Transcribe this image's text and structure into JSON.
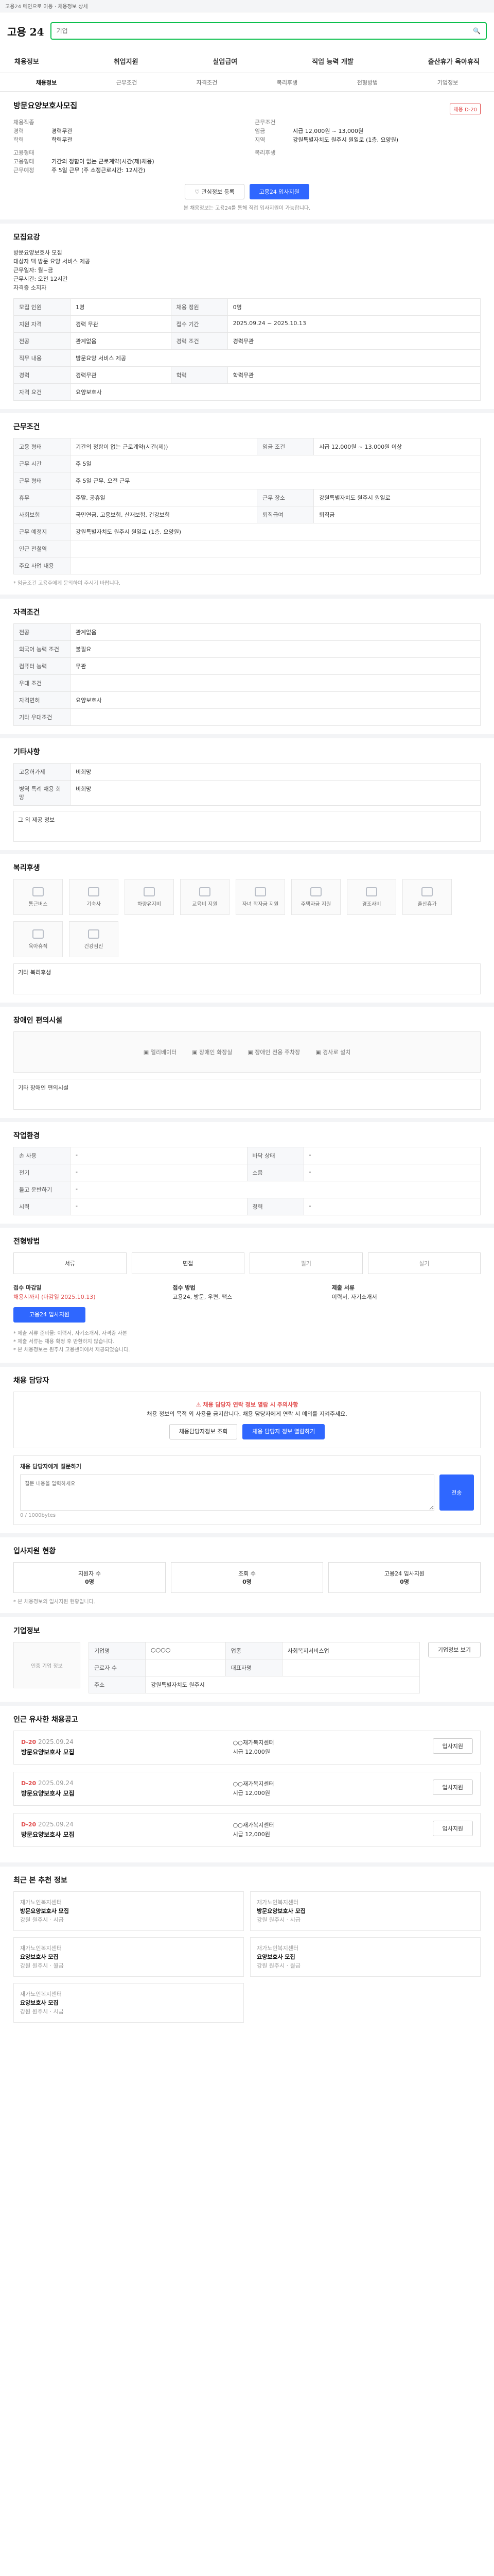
{
  "topbar": {
    "text": "고용24 메인으로 이동 · 채용정보 상세"
  },
  "header": {
    "logo": "고용 24",
    "search_placeholder": "기업"
  },
  "gnb": [
    "채용정보",
    "취업지원",
    "실업급여",
    "직업 능력 개발",
    "출산휴가 육아휴직"
  ],
  "subnav": [
    "채용정보",
    "근무조건",
    "자격조건",
    "복리후생",
    "전형방법",
    "기업정보"
  ],
  "job": {
    "title": "방문요양보호사모집",
    "badge": "채용 D-20",
    "left": [
      {
        "k": "채용직종",
        "v": ""
      },
      {
        "k": "경력",
        "v": "경력무관"
      },
      {
        "k": "학력",
        "v": "학력무관"
      },
      {
        "k": "고용형태",
        "v": ""
      },
      {
        "k": "고용형태",
        "v": "기간의 정함이 없는 근로계약(시간(제)채용)"
      },
      {
        "k": "근무예정",
        "v": "주 5일 근무 (주 소정근로시간: 12시간)"
      }
    ],
    "right": [
      {
        "k": "근무조건",
        "v": ""
      },
      {
        "k": "임금",
        "v": "시급 12,000원 ~ 13,000원"
      },
      {
        "k": "지역",
        "v": "강원특별자치도 원주시 원일로 (1층, 요양원)"
      },
      {
        "k": "복리후생",
        "v": ""
      }
    ],
    "buttons": {
      "save": "관심정보 등록",
      "apply": "고용24 입사지원"
    },
    "note": "본 채용정보는 고용24를 통해 직접 입사지원이 가능합니다."
  },
  "recruit": {
    "title": "모집요강",
    "desc": [
      "방문요양보호사 모집",
      "대상자 댁 방문 요양 서비스 제공",
      "근무일자: 월~금",
      "근무시간: 오전 12시간",
      "자격증 소지자"
    ],
    "rows": [
      [
        "모집 인원",
        "1명",
        "채용 정원",
        "0명"
      ],
      [
        "지원 자격",
        "경력 무관",
        "접수 기간",
        "2025.09.24 ~ 2025.10.13"
      ],
      [
        "전공",
        "관계없음",
        "경력 조건",
        "경력무관"
      ],
      [
        "직무 내용",
        "방문요양 서비스 제공",
        "",
        ""
      ],
      [
        "경력",
        "경력무관",
        "학력",
        "학력무관"
      ],
      [
        "자격 요건",
        "요양보호사",
        "",
        ""
      ]
    ]
  },
  "conditions": {
    "title": "근무조건",
    "rows": [
      [
        "고용 형태",
        "기간의 정함이 없는 근로계약(시간(제))",
        "임금 조건",
        "시급 12,000원 ~ 13,000원 이상"
      ],
      [
        "근무 시간",
        "주 5일",
        "",
        ""
      ],
      [
        "근무 형태",
        "주 5일 근무, 오전 근무",
        "",
        ""
      ],
      [
        "휴무",
        "주말, 공휴일",
        "근무 장소",
        "강원특별자치도 원주시 원일로"
      ],
      [
        "사회보험",
        "국민연금, 고용보험, 산재보험, 건강보험",
        "퇴직급여",
        "퇴직금"
      ],
      [
        "근무 예정지",
        "강원특별자치도 원주시 원일로 (1층, 요양원)",
        "",
        ""
      ],
      [
        "인근 전철역",
        "",
        "",
        ""
      ],
      [
        "주요 사업 내용",
        "",
        "",
        ""
      ]
    ],
    "note": "* 임금조건 고용주에게 문의하여 주시기 바랍니다."
  },
  "qualification": {
    "title": "자격조건",
    "rows": [
      [
        "전공",
        "관계없음"
      ],
      [
        "외국어 능력 조건",
        "불필요"
      ],
      [
        "컴퓨터 능력",
        "무관"
      ],
      [
        "우대 조건",
        ""
      ],
      [
        "자격면허",
        "요양보호사"
      ],
      [
        "기타 우대조건",
        ""
      ]
    ]
  },
  "etc": {
    "title": "기타사항",
    "rows": [
      [
        "고용허가제",
        "비희망"
      ],
      [
        "병역 특례 채용 희망",
        "비희망"
      ]
    ],
    "note": "그 외 제공 정보"
  },
  "welfare": {
    "title": "복리후생",
    "items": [
      "통근버스",
      "기숙사",
      "차량유지비",
      "교육비 지원",
      "자녀 학자금 지원",
      "주택자금 지원",
      "경조사비",
      "출산휴가",
      "육아휴직",
      "건강검진"
    ],
    "note": "기타 복리후생"
  },
  "disabled": {
    "title": "장애인 편의시설",
    "items": [
      "엘리베이터",
      "장애인 화장실",
      "장애인 전용 주차장",
      "경사로 설치"
    ],
    "note": "기타 장애인 편의시설"
  },
  "workplace": {
    "title": "작업환경",
    "rows": [
      [
        "손 사용",
        "-",
        "바닥 상태",
        "-"
      ],
      [
        "전기",
        "-",
        "소음",
        "-"
      ],
      [
        "들고 운반하기",
        "-",
        "",
        ""
      ],
      [
        "시력",
        "-",
        "청력",
        "-"
      ]
    ]
  },
  "selection": {
    "title": "전형방법",
    "steps": [
      "서류",
      "면접",
      "필기",
      "실기"
    ],
    "apply": [
      {
        "k": "접수 마감일",
        "v": "채용시까지 (마감일 2025.10.13)"
      },
      {
        "k": "접수 방법",
        "v": "고용24, 방문, 우편, 팩스"
      },
      {
        "k": "제출 서류",
        "v": "이력서, 자기소개서"
      }
    ],
    "apply_button": "고용24 입사지원",
    "notes": [
      "* 제출 서류 준비물: 이력서, 자기소개서, 자격증 사본",
      "* 제출 서류는 채용 확정 후 반환하지 않습니다.",
      "* 본 채용정보는 원주시 고용센터에서 제공되었습니다."
    ]
  },
  "contact": {
    "title": "채용 담당자",
    "warn_title": "채용 담당자 연락 정보 열람 시 주의사항",
    "warn_text": "채용 정보의 목적 외 사용을 금지합니다. 채용 담당자에게 연락 시 예의를 지켜주세요.",
    "btn1": "채용담당자정보 조회",
    "btn2": "채용 담당자 정보 열람하기",
    "inquiry_title": "채용 담당자에게 질문하기",
    "inquiry_placeholder": "질문 내용을 입력하세요",
    "count": "0 / 1000bytes",
    "send": "전송"
  },
  "matching": {
    "title": "입사지원 현황",
    "items": [
      {
        "k": "지원자 수",
        "v": "0명"
      },
      {
        "k": "조회 수",
        "v": "0명"
      },
      {
        "k": "고용24 입사지원",
        "v": "0명"
      }
    ],
    "note": "* 본 채용정보의 입사지원 현황입니다."
  },
  "company": {
    "title": "기업정보",
    "info_title": "인증 기업 정보",
    "rows": [
      [
        "기업명",
        "○○○○",
        "업종",
        "사회복지서비스업"
      ],
      [
        "근로자 수",
        "",
        "대표자명",
        ""
      ],
      [
        "주소",
        "강원특별자치도 원주시",
        "",
        ""
      ]
    ],
    "button": "기업정보 보기"
  },
  "similar": {
    "title": "인근 유사한 채용공고",
    "items": [
      {
        "dday": "D-20",
        "date": "2025.09.24",
        "title": "방문요양보호사 모집",
        "company": "○○재가복지센터",
        "pay": "시급 12,000원"
      },
      {
        "dday": "D-20",
        "date": "2025.09.24",
        "title": "방문요양보호사 모집",
        "company": "○○재가복지센터",
        "pay": "시급 12,000원"
      },
      {
        "dday": "D-20",
        "date": "2025.09.24",
        "title": "방문요양보호사 모집",
        "company": "○○재가복지센터",
        "pay": "시급 12,000원"
      }
    ],
    "more_button": "입사지원"
  },
  "recent": {
    "title": "최근 본 추천 정보",
    "cards": [
      {
        "tag": "재가노인복지센터",
        "title": "방문요양보호사 모집",
        "meta": "강원 원주시 · 시급"
      },
      {
        "tag": "재가노인복지센터",
        "title": "방문요양보호사 모집",
        "meta": "강원 원주시 · 시급"
      },
      {
        "tag": "재가노인복지센터",
        "title": "요양보호사 모집",
        "meta": "강원 원주시 · 월급"
      },
      {
        "tag": "재가노인복지센터",
        "title": "요양보호사 모집",
        "meta": "강원 원주시 · 월급"
      },
      {
        "tag": "재가노인복지센터",
        "title": "요양보호사 모집",
        "meta": "강원 원주시 · 시급"
      }
    ]
  }
}
